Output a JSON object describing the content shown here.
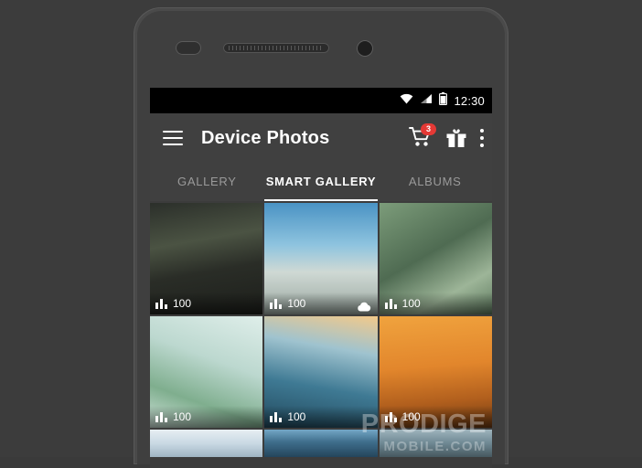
{
  "statusbar": {
    "clock": "12:30",
    "icons": [
      "wifi-icon",
      "signal-icon",
      "battery-icon"
    ]
  },
  "appbar": {
    "menu_icon": "hamburger-menu-icon",
    "title": "Device Photos",
    "cart_icon": "shopping-cart-icon",
    "cart_badge": "3",
    "gift_icon": "gift-icon",
    "overflow_icon": "kebab-menu-icon"
  },
  "tabs": [
    {
      "label": "Gallery",
      "active": false
    },
    {
      "label": "Smart gallery",
      "active": true
    },
    {
      "label": "Albums",
      "active": false
    }
  ],
  "grid": {
    "items": [
      {
        "name": "forest-photo",
        "count": "100",
        "cloud": false,
        "css": "linear-gradient(170deg,#2b2f2a 0%,#4b5343 35%,#2a2d27 60%,#1d1f1b 100%)"
      },
      {
        "name": "beach-photo",
        "count": "100",
        "cloud": true,
        "css": "linear-gradient(180deg,#4a93c4 0%,#8fc4df 38%,#cfd9d4 62%,#9aa7a0 100%)"
      },
      {
        "name": "succulent-photo",
        "count": "100",
        "cloud": false,
        "css": "linear-gradient(150deg,#7c9c7a 0%,#4f6b52 45%,#9db598 75%,#5e7a5f 100%)"
      },
      {
        "name": "coastline-photo",
        "count": "100",
        "cloud": false,
        "css": "linear-gradient(200deg,#dfeeea 0%,#bcd8cf 40%,#7fae8e 72%,#cfe3da 100%)"
      },
      {
        "name": "wave-photo",
        "count": "100",
        "cloud": false,
        "css": "linear-gradient(190deg,#f2c98a 0%,#9fc3cf 30%,#3f7a94 62%,#21485c 100%)"
      },
      {
        "name": "deer-sunset-photo",
        "count": "100",
        "cloud": false,
        "css": "linear-gradient(175deg,#f0a33e 0%,#e2862c 45%,#b15f1d 75%,#6e3a12 100%)"
      },
      {
        "name": "sky-photo",
        "count": "",
        "cloud": false,
        "css": "linear-gradient(180deg,#e7eef2 0%,#c9d9e4 50%,#9fb4c2 100%)"
      },
      {
        "name": "mountain-lake-photo",
        "count": "",
        "cloud": false,
        "css": "linear-gradient(180deg,#74a7c6 0%,#3f6e8c 45%,#24455c 100%)"
      },
      {
        "name": "snow-photo",
        "count": "",
        "cloud": false,
        "css": "linear-gradient(180deg,#9fb4bd 0%,#6e8893 50%,#46585f 100%)"
      }
    ]
  },
  "watermark": {
    "line1": "PRODIGE",
    "line2": "MOBILE.COM"
  },
  "colors": {
    "appbar_bg": "#404040",
    "accent_badge": "#e53935",
    "screen_bg": "#3c3c3c",
    "phone_body": "#4a4a4a"
  }
}
